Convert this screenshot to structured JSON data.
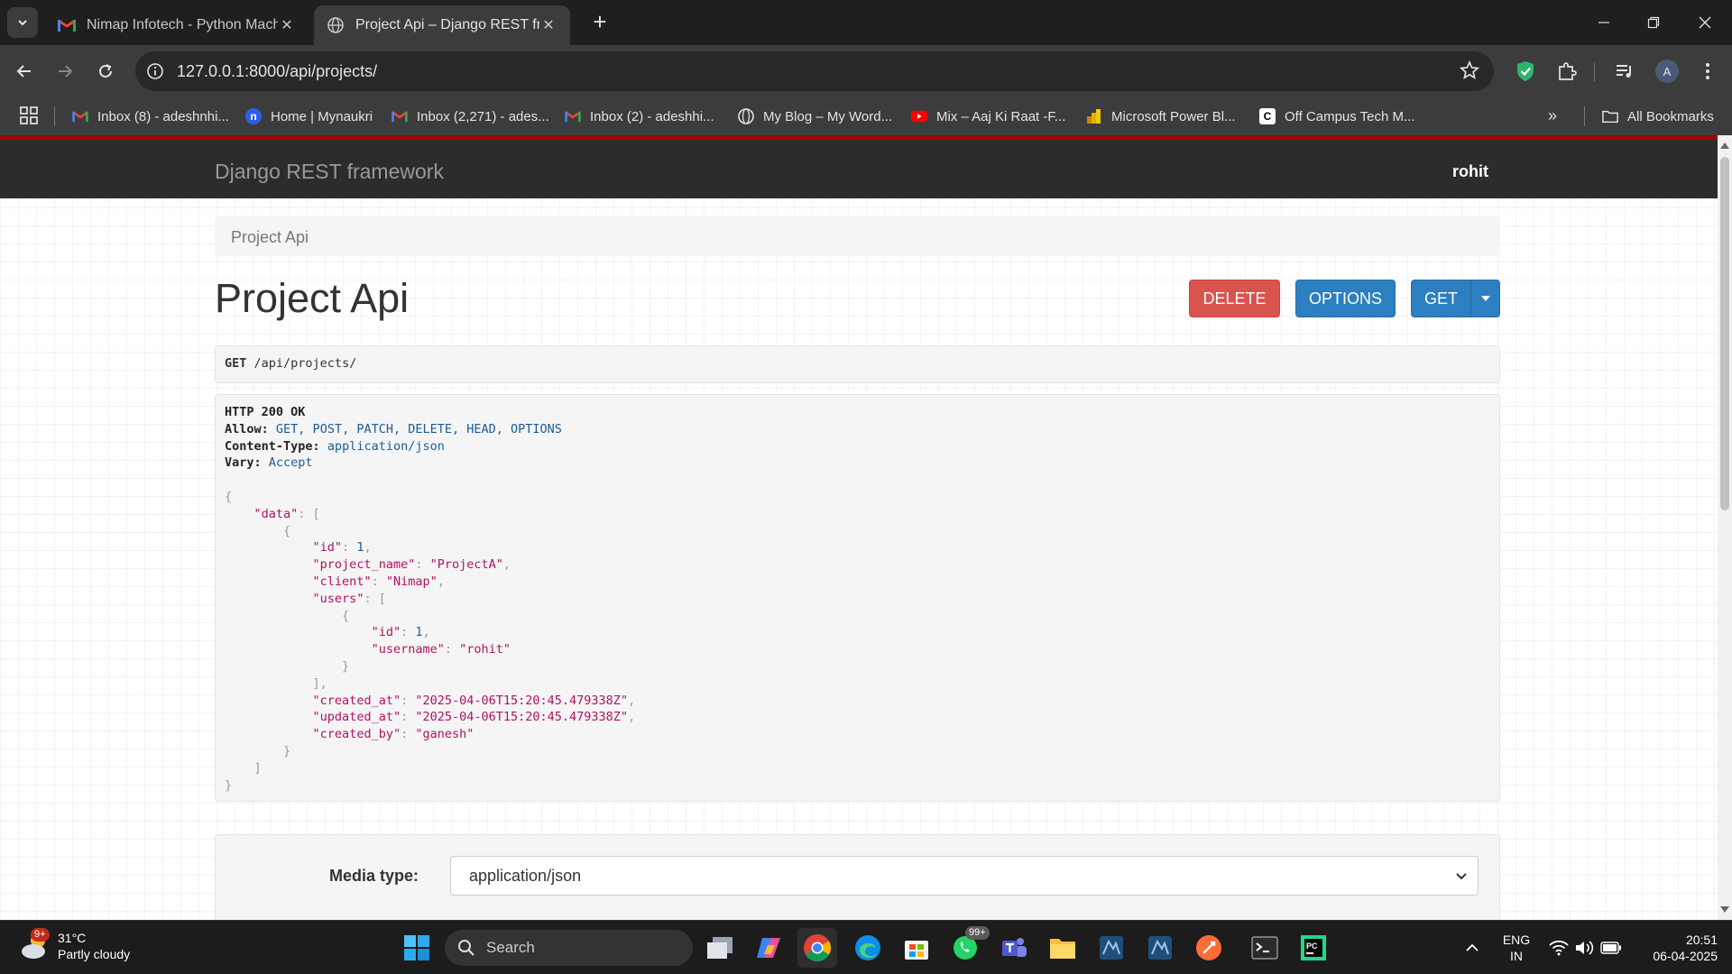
{
  "browser": {
    "tabs": [
      {
        "title": "Nimap Infotech - Python Machi",
        "active": false
      },
      {
        "title": "Project Api – Django REST fram",
        "active": true
      }
    ],
    "url": "127.0.0.1:8000/api/projects/",
    "profile_initial": "A"
  },
  "bookmarks": {
    "items": [
      {
        "label": "Inbox (8) - adeshnhi..."
      },
      {
        "label": "Home | Mynaukri"
      },
      {
        "label": "Inbox (2,271) - ades..."
      },
      {
        "label": "Inbox (2) - adeshhi..."
      },
      {
        "label": "My Blog – My Word..."
      },
      {
        "label": "Mix – Aaj Ki Raat -F..."
      },
      {
        "label": "Microsoft Power Bl..."
      },
      {
        "label": "Off Campus Tech M..."
      }
    ],
    "all_bookmarks": "All Bookmarks"
  },
  "drf": {
    "brand": "Django REST framework",
    "user": "rohit",
    "breadcrumb": "Project Api",
    "heading": "Project Api",
    "buttons": {
      "delete": "DELETE",
      "options": "OPTIONS",
      "get": "GET"
    },
    "request": {
      "method": "GET",
      "path": "/api/projects/"
    },
    "response": {
      "status": "HTTP 200 OK",
      "headers": [
        {
          "name": "Allow:",
          "value": "GET, POST, PATCH, DELETE, HEAD, OPTIONS"
        },
        {
          "name": "Content-Type:",
          "value": "application/json"
        },
        {
          "name": "Vary:",
          "value": "Accept"
        }
      ],
      "body": {
        "data_key": "\"data\"",
        "id_key": "\"id\"",
        "id_val": "1",
        "project_name_key": "\"project_name\"",
        "project_name_val": "\"ProjectA\"",
        "client_key": "\"client\"",
        "client_val": "\"Nimap\"",
        "users_key": "\"users\"",
        "user_id_key": "\"id\"",
        "user_id_val": "1",
        "username_key": "\"username\"",
        "username_val": "\"rohit\"",
        "created_at_key": "\"created_at\"",
        "created_at_val": "\"2025-04-06T15:20:45.479338Z\"",
        "updated_at_key": "\"updated_at\"",
        "updated_at_val": "\"2025-04-06T15:20:45.479338Z\"",
        "created_by_key": "\"created_by\"",
        "created_by_val": "\"ganesh\""
      }
    },
    "media": {
      "label": "Media type:",
      "selected": "application/json"
    }
  },
  "taskbar": {
    "weather": {
      "temp": "31°C",
      "desc": "Partly cloudy",
      "badge": "9+"
    },
    "search": "Search",
    "whatsapp_badge": "99+",
    "lang": {
      "l1": "ENG",
      "l2": "IN"
    },
    "time": "20:51",
    "date": "06-04-2025"
  },
  "colors": {
    "drf_red": "#a30000",
    "delete": "#d9534f",
    "primary": "#2c7fc0"
  }
}
